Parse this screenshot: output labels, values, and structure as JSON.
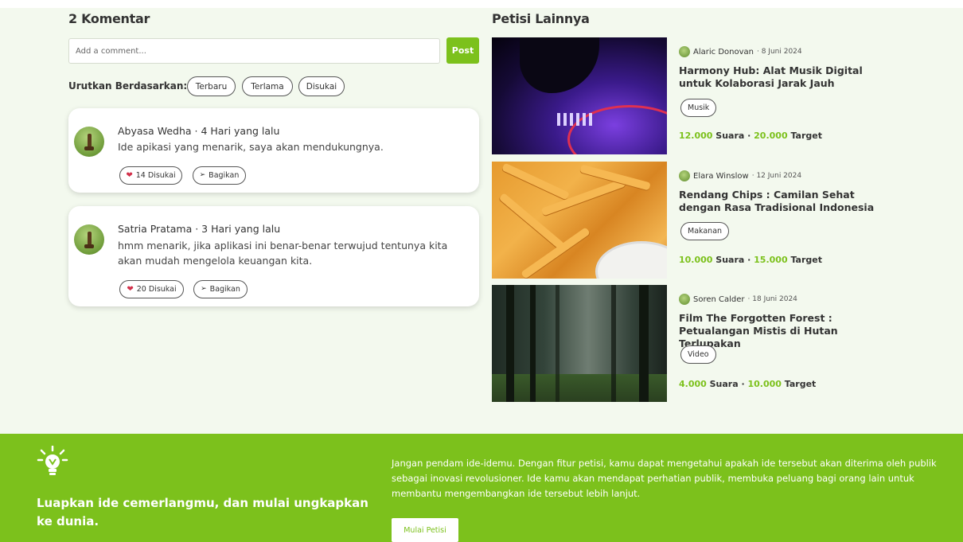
{
  "comments": {
    "title": "2 Komentar",
    "input_placeholder": "Add a comment...",
    "post_label": "Post",
    "sort_label": "Urutkan Berdasarkan:",
    "sort_options": [
      "Terbaru",
      "Terlama",
      "Disukai"
    ],
    "items": [
      {
        "author": "Abyasa Wedha · 4 Hari yang lalu",
        "text": "Ide apikasi yang menarik, saya akan mendukungnya.",
        "likes": "14 Disukai",
        "share": "Bagikan"
      },
      {
        "author": "Satria Pratama · 3 Hari yang lalu",
        "text": "hmm menarik, jika aplikasi ini benar-benar terwujud tentunya kita akan mudah mengelola keuangan kita.",
        "likes": "20 Disukai",
        "share": "Bagikan"
      }
    ]
  },
  "petitions": {
    "title": "Petisi Lainnya",
    "items": [
      {
        "author": "Alaric Donovan",
        "date": "· 8 Juni 2024",
        "title": "Harmony Hub: Alat Musik Digital untuk Kolaborasi Jarak Jauh",
        "tag": "Musik",
        "votes": "12.000",
        "votes_label": " Suara · ",
        "target": "20.000",
        "target_label": " Target",
        "image": "dj-turntable"
      },
      {
        "author": "Elara Winslow",
        "date": "· 12 Juni 2024",
        "title": "Rendang Chips : Camilan Sehat dengan Rasa Tradisional Indonesia",
        "tag": "Makanan",
        "votes": "10.000",
        "votes_label": " Suara · ",
        "target": "15.000",
        "target_label": " Target",
        "image": "fries-with-dip"
      },
      {
        "author": "Soren Calder",
        "date": "· 18 Juni 2024",
        "title": "Film The Forgotten Forest : Petualangan Mistis di Hutan Terlupakan",
        "tag": "Video",
        "votes": "4.000",
        "votes_label": " Suara · ",
        "target": "10.000",
        "target_label": " Target",
        "image": "misty-forest"
      }
    ]
  },
  "footer": {
    "icon": "lightbulb-icon",
    "heading": "Luapkan ide cemerlangmu, dan mulai ungkapkan ke dunia.",
    "text": "Jangan pendam ide-idemu. Dengan fitur petisi, kamu dapat mengetahui apakah ide tersebut akan diterima oleh publik sebagai inovasi revolusioner. Ide kamu akan mendapat perhatian publik, membuka peluang bagi orang lain untuk membantu mengembangkan ide tersebut lebih lanjut.",
    "button": "Mulai Petisi"
  },
  "colors": {
    "accent": "#7cc11c",
    "background": "#f3f9ee",
    "heart": "#d2314b"
  }
}
